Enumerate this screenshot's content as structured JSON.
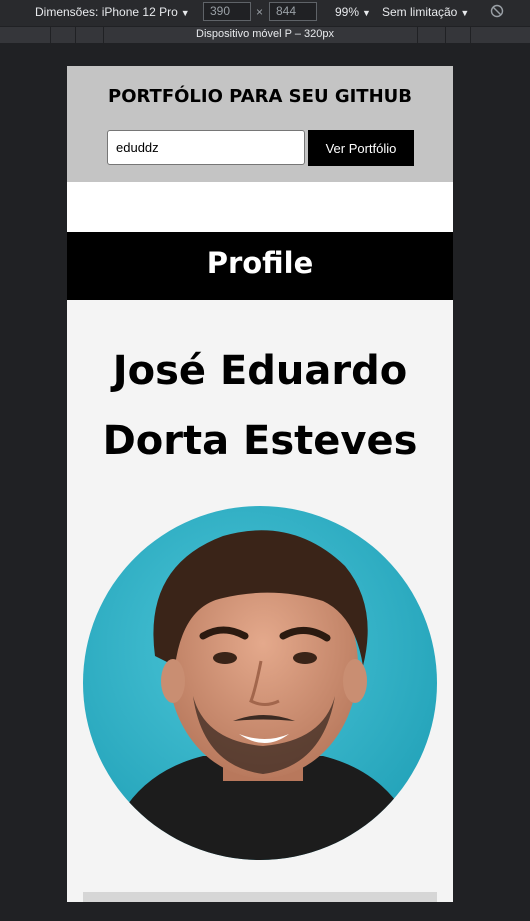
{
  "devtools": {
    "dimensions_label": "Dimensões: iPhone 12 Pro",
    "width_value": "390",
    "times_symbol": "×",
    "height_value": "844",
    "zoom_label": "99%",
    "throttle_label": "Sem limitação",
    "media_query_label": "Dispositivo móvel P – 320px"
  },
  "header": {
    "title": "PORTFÓLIO PARA SEU GITHUB",
    "input_value": "eduddz",
    "button_label": "Ver Portfólio"
  },
  "profile": {
    "section_title": "Profile",
    "name": "José Eduardo Dorta Esteves"
  },
  "colors": {
    "header_bg": "#c4c4c4",
    "band_bg": "#000000",
    "page_bg": "#f4f4f4",
    "avatar_bg": "#2bb3c9"
  }
}
